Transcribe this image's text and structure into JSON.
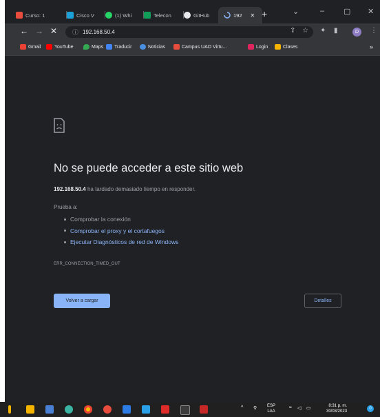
{
  "browser": {
    "tabs": [
      {
        "label": "Curso: 1",
        "icon": "moodle-icon",
        "color": "#e74c3c"
      },
      {
        "label": "Cisco V",
        "icon": "cisco-icon",
        "color": "#1ba0d7"
      },
      {
        "label": "(1) Whi",
        "icon": "whatsapp-icon",
        "color": "#25d366"
      },
      {
        "label": "Telecon",
        "icon": "sheets-icon",
        "color": "#0f9d58"
      },
      {
        "label": "GitHub",
        "icon": "github-icon",
        "color": "#e8eaed"
      },
      {
        "label": "192",
        "icon": "loading-icon",
        "color": "#8ab4f8"
      }
    ],
    "new_tab_glyph": "+",
    "window_controls": {
      "dropdown": "⌄",
      "minimize": "–",
      "maximize": "▢",
      "close": "✕"
    },
    "address": "192.168.50.4",
    "profile_initial": "D",
    "bookmarks": [
      {
        "label": "Gmail",
        "color": "#ea4335"
      },
      {
        "label": "YouTube",
        "color": "#ff0000"
      },
      {
        "label": "Maps",
        "color": "#34a853"
      },
      {
        "label": "Traducir",
        "color": "#4285f4"
      },
      {
        "label": "Noticias",
        "color": "#4a90e2"
      },
      {
        "label": "Campus UAO Virtu...",
        "color": "#e74c3c"
      },
      {
        "label": "Login",
        "color": "#e0245e"
      },
      {
        "label": "Clases",
        "color": "#f4b400"
      }
    ],
    "bookmarks_more": "»"
  },
  "error_page": {
    "title": "No se puede acceder a este sitio web",
    "host": "192.168.50.4",
    "message": "ha tardado demasiado tiempo en responder.",
    "try_label": "Prueba a:",
    "suggestions": [
      "Comprobar la conexión",
      "Comprobar el proxy y el cortafuegos",
      "Ejecutar Diagnósticos de red de Windows"
    ],
    "error_code": "ERR_CONNECTION_TIMED_OUT",
    "reload_label": "Volver a cargar",
    "details_label": "Detalles"
  },
  "taskbar": {
    "lang_line1": "ESP",
    "lang_line2": "LAA",
    "time": "8:31 p. m.",
    "date": "30/03/2023",
    "notification_count": "0",
    "tray_chevron": "^"
  }
}
